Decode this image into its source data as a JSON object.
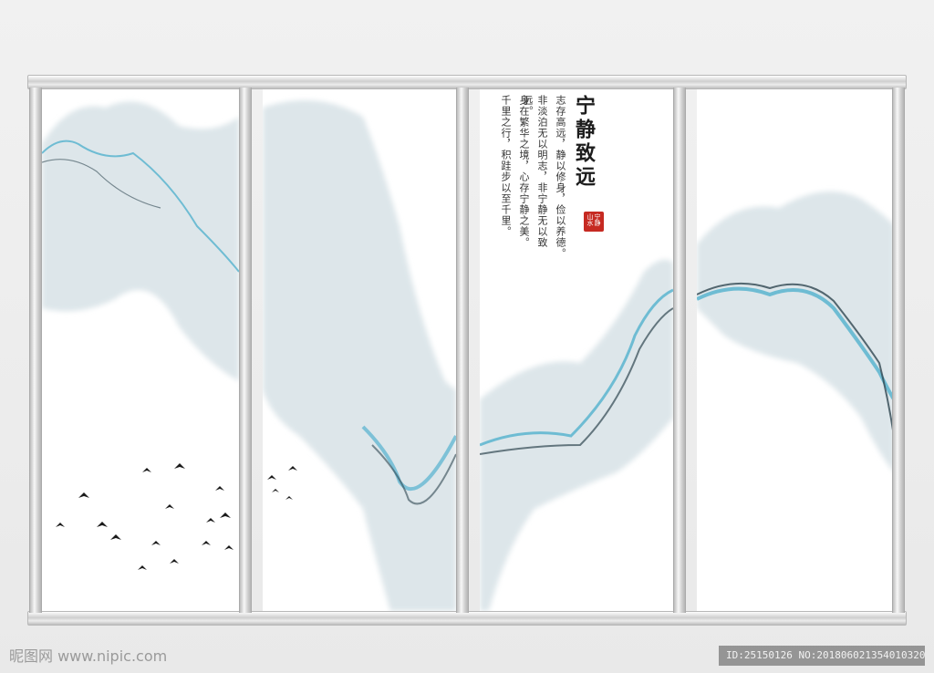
{
  "artwork": {
    "title": "宁静致远",
    "poem_lines": [
      "志存高远，静以修身，俭以养德。",
      "非淡泊无以明志，非宁静无以致远。",
      "身在繁华之境，心存宁静之美。",
      "千里之行，积跬步以至千里。"
    ],
    "seal_text": "宁静山水",
    "colors": {
      "ink_blue": "#3ea9c9",
      "ink_dark": "#2f4650",
      "mist": "#dde6ea",
      "seal_red": "#c62a22"
    }
  },
  "watermark": {
    "site": "昵图网 www.nipic.com",
    "id_text": "ID:25150126 NO:20180602135401032030"
  }
}
